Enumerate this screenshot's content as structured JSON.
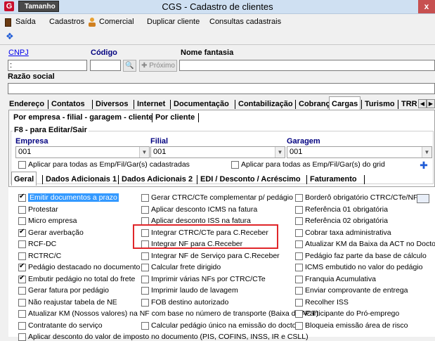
{
  "window": {
    "title": "CGS - Cadastro de clientes",
    "size_button": "Tamanho",
    "close": "x",
    "app_icon": "G"
  },
  "menu": {
    "saida": "Saída",
    "cadastros": "Cadastros",
    "comercial": "Comercial",
    "duplicar": "Duplicar cliente",
    "consultas": "Consultas cadastrais"
  },
  "header_fields": {
    "cnpj_label": "CNPJ",
    "codigo_label": "Código",
    "nome_fantasia_label": "Nome fantasia",
    "cnpj_value": ":",
    "codigo_value": "",
    "nome_fantasia_value": "",
    "proximo_label": "Próximo",
    "razao_social_label": "Razão social",
    "razao_social_value": ""
  },
  "main_tabs": [
    "Endereço",
    "Contatos",
    "Diversos",
    "Internet",
    "Documentação",
    "Contabilização",
    "Cobrança",
    "Cargas",
    "Turismo",
    "TRR"
  ],
  "main_tabs_active": "Cargas",
  "sub_tabs": [
    "Por empresa - filial - garagem - cliente",
    "Por cliente"
  ],
  "group": {
    "title": "F8 - para Editar/Sair",
    "empresa_label": "Empresa",
    "filial_label": "Filial",
    "garagem_label": "Garagem",
    "empresa_value": "001",
    "filial_value": "001",
    "garagem_value": "001",
    "apply_all_registered": "Aplicar para todas as Emp/Fil/Gar(s) cadastradas",
    "apply_all_grid": "Aplicar para todas as Emp/Fil/Gar(s) do grid"
  },
  "inner_tabs": [
    "Geral",
    "Dados Adicionais 1",
    "Dados Adicionais 2",
    "EDI / Desconto / Acréscimo",
    "Faturamento"
  ],
  "inner_tabs_active": "Geral",
  "checkboxes": {
    "col1": [
      {
        "label": "Emitir documentos a prazo",
        "checked": true,
        "highlight": true
      },
      {
        "label": "Protestar",
        "checked": false
      },
      {
        "label": "Micro empresa",
        "checked": false
      },
      {
        "label": "Gerar averbação",
        "checked": true
      },
      {
        "label": "RCF-DC",
        "checked": false
      },
      {
        "label": "RCTRC/C",
        "checked": false
      },
      {
        "label": "Pedágio destacado no documento",
        "checked": true
      },
      {
        "label": "Embutir pedágio no total do frete",
        "checked": true
      },
      {
        "label": "Gerar fatura por pedágio",
        "checked": false
      },
      {
        "label": "Não reajustar tabela de NE",
        "checked": false
      }
    ],
    "col2": [
      {
        "label": "Gerar CTRC/CTe complementar p/ pedágio",
        "checked": false
      },
      {
        "label": "Aplicar desconto ICMS na fatura",
        "checked": false
      },
      {
        "label": "Aplicar desconto ISS na fatura",
        "checked": false
      },
      {
        "label": "Integrar CTRC/CTe para C.Receber",
        "checked": false
      },
      {
        "label": "Integrar NF para C.Receber",
        "checked": false
      },
      {
        "label": "Integrar NF de Serviço para C.Receber",
        "checked": false
      },
      {
        "label": "Calcular frete dirigido",
        "checked": false
      },
      {
        "label": "Imprimir várias NFs por CTRC/CTe",
        "checked": false
      },
      {
        "label": "Imprimir laudo de lavagem",
        "checked": false
      },
      {
        "label": "FOB destino autorizado",
        "checked": false
      }
    ],
    "col3": [
      {
        "label": "Borderô obrigatório  CTRC/CTe/NF",
        "checked": false
      },
      {
        "label": "Referência 01 obrigatória",
        "checked": false
      },
      {
        "label": "Referência 02 obrigatória",
        "checked": false
      },
      {
        "label": "Cobrar taxa administrativa",
        "checked": false
      },
      {
        "label": "Atualizar KM da Baixa da ACT no Docto",
        "checked": false
      },
      {
        "label": "Pedágio faz parte da base de cálculo",
        "checked": false
      },
      {
        "label": "ICMS embutido no valor do pedágio",
        "checked": false
      },
      {
        "label": "Franquia Acumulativa",
        "checked": false
      },
      {
        "label": "Enviar comprovante de entrega",
        "checked": false
      },
      {
        "label": "Recolher ISS",
        "checked": false
      }
    ],
    "row_wide1": {
      "label": "Atualizar KM (Nossos valores) na NF com base no número de transporte (Baixa de ACT)",
      "checked": false
    },
    "row_wide1_right": {
      "label": "Participante do Pró-emprego",
      "checked": false
    },
    "row_contratante": {
      "label": "Contratante do serviço",
      "checked": false
    },
    "row_calc_pedagio": {
      "label": "Calcular pedágio único na emissão do docto",
      "checked": false
    },
    "row_bloqueia": {
      "label": "Bloqueia emissão área de risco",
      "checked": false
    },
    "row_last": {
      "label": "Aplicar desconto do valor de imposto no documento (PIS, COFINS, INSS, IR e CSLL)",
      "checked": false
    }
  },
  "colors": {
    "highlight_box": "#e0262a",
    "selection": "#3399ff",
    "link": "#0000ee"
  }
}
